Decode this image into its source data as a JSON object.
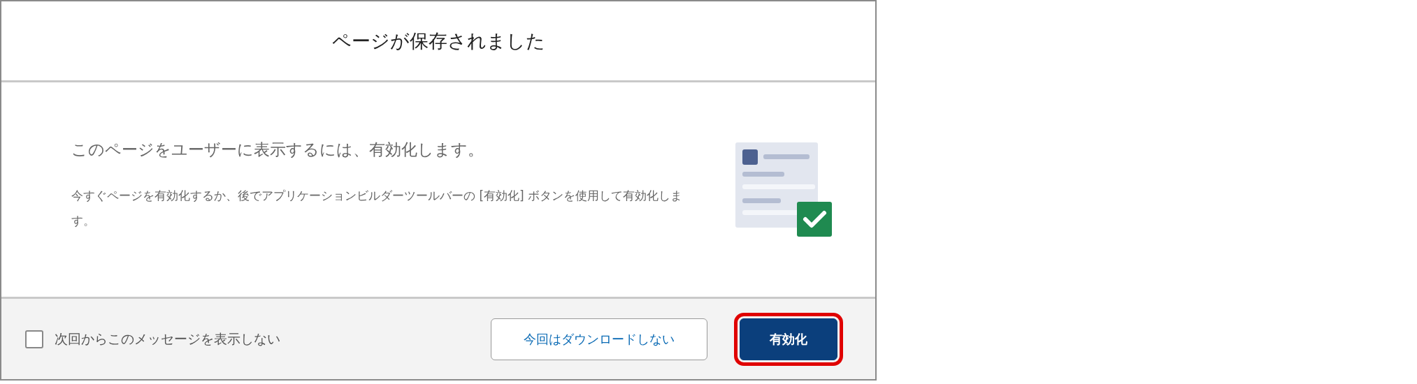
{
  "dialog": {
    "title": "ページが保存されました",
    "heading": "このページをユーザーに表示するには、有効化します。",
    "description": "今すぐページを有効化するか、後でアプリケーションビルダーツールバーの [有効化] ボタンを使用して有効化します。",
    "footer": {
      "checkbox": {
        "label": "次回からこのメッセージを表示しない",
        "checked": false
      },
      "buttons": [
        {
          "label": "今回はダウンロードしない",
          "kind": "secondary",
          "highlighted": false
        },
        {
          "label": "有効化",
          "kind": "primary",
          "highlighted": true
        }
      ]
    }
  }
}
